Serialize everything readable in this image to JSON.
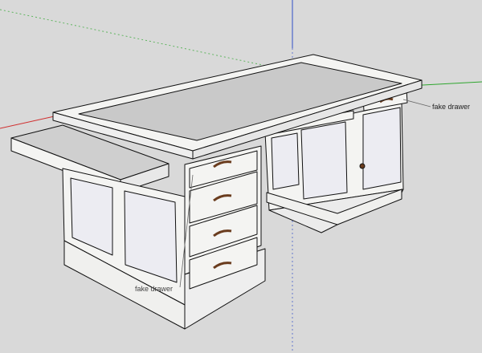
{
  "viewport": {
    "background": "#d9d9d9",
    "axis_colors": {
      "red": "#d03030",
      "green": "#2ea62e",
      "blue": "#3050c8"
    }
  },
  "model": {
    "name": "pedestal desk",
    "colors": {
      "frame": "#f4f4f2",
      "panel": "#ececf2",
      "top_panel": "#c9c9c9",
      "edge": "#111111",
      "handle": "#6a3c1e"
    }
  },
  "annotations": {
    "right_drawer": "fake drawer",
    "left_drawer": "fake drawer"
  }
}
